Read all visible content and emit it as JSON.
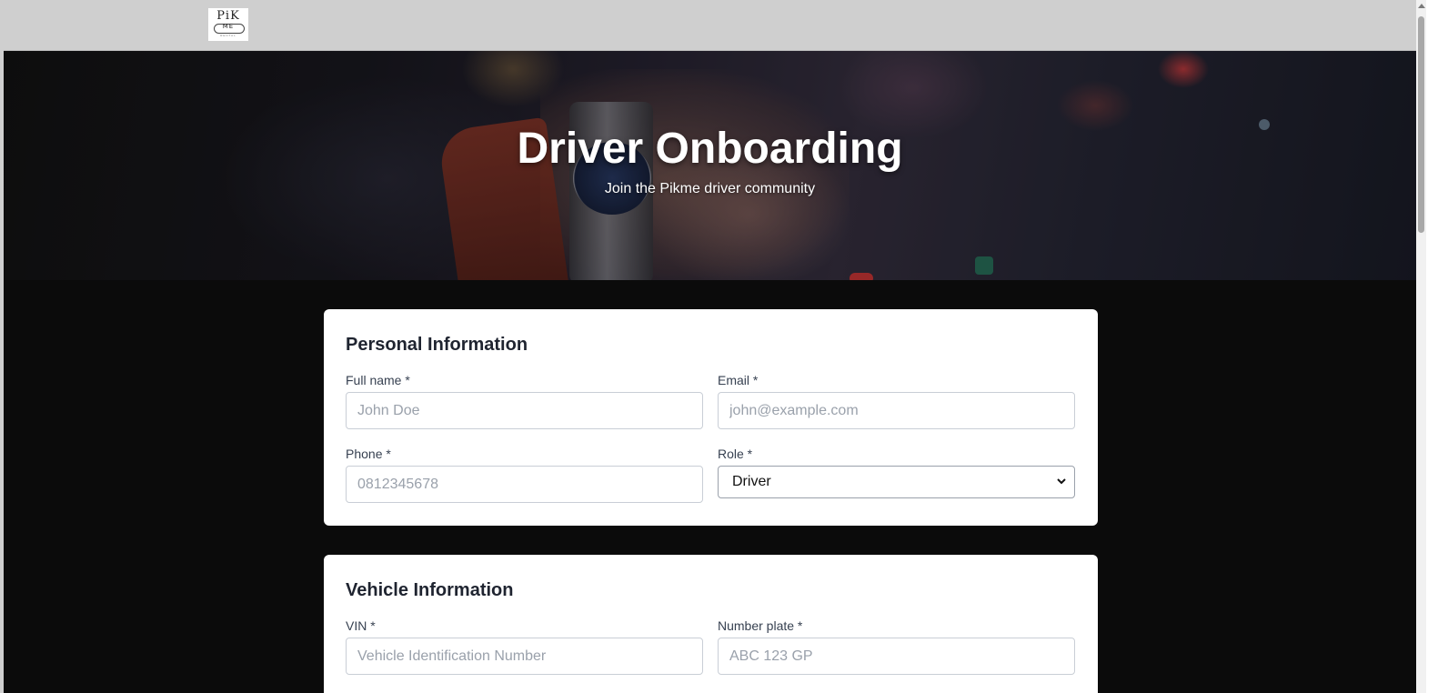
{
  "header": {
    "logo": {
      "line1": "PiK",
      "line2": "ME",
      "line3": "RENTAL"
    }
  },
  "hero": {
    "title": "Driver Onboarding",
    "subtitle": "Join the Pikme driver community"
  },
  "personal": {
    "heading": "Personal Information",
    "full_name": {
      "label": "Full name *",
      "placeholder": "John Doe",
      "value": ""
    },
    "email": {
      "label": "Email *",
      "placeholder": "john@example.com",
      "value": ""
    },
    "phone": {
      "label": "Phone *",
      "placeholder": "0812345678",
      "value": ""
    },
    "role": {
      "label": "Role *",
      "selected": "Driver"
    }
  },
  "vehicle": {
    "heading": "Vehicle Information",
    "vin": {
      "label": "VIN *",
      "placeholder": "Vehicle Identification Number",
      "value": ""
    },
    "plate": {
      "label": "Number plate *",
      "placeholder": "ABC 123 GP",
      "value": ""
    }
  },
  "colors": {
    "topbar": "#cfcfcf",
    "page_bg": "#0b0b0b",
    "card_bg": "#ffffff",
    "heading_text": "#1f2430"
  }
}
